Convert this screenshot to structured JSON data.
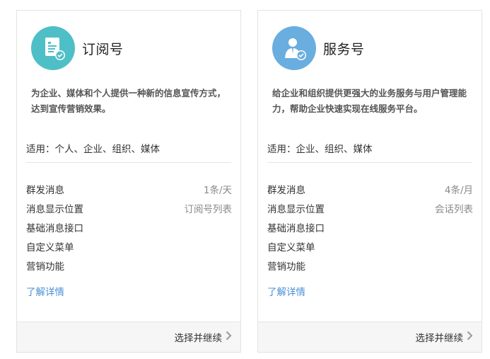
{
  "cards": [
    {
      "title": "订阅号",
      "description": "为企业、媒体和个人提供一种新的信息宣传方式，达到宣传营销效果。",
      "applies_to": "适用：个人、企业、组织、媒体",
      "features": [
        {
          "label": "群发消息",
          "value": "1条/天"
        },
        {
          "label": "消息显示位置",
          "value": "订阅号列表"
        },
        {
          "label": "基础消息接口",
          "value": ""
        },
        {
          "label": "自定义菜单",
          "value": ""
        },
        {
          "label": "营销功能",
          "value": ""
        }
      ],
      "learn_more": "了解详情",
      "select_button": "选择并继续",
      "icon": "document-check-icon",
      "icon_color": "#4ebfc7"
    },
    {
      "title": "服务号",
      "description": "给企业和组织提供更强大的业务服务与用户管理能力，帮助企业快速实现在线服务平台。",
      "applies_to": "适用：企业、组织、媒体",
      "features": [
        {
          "label": "群发消息",
          "value": "4条/月"
        },
        {
          "label": "消息显示位置",
          "value": "会话列表"
        },
        {
          "label": "基础消息接口",
          "value": ""
        },
        {
          "label": "自定义菜单",
          "value": ""
        },
        {
          "label": "营销功能",
          "value": ""
        }
      ],
      "learn_more": "了解详情",
      "select_button": "选择并继续",
      "icon": "person-check-icon",
      "icon_color": "#69aedf"
    }
  ]
}
